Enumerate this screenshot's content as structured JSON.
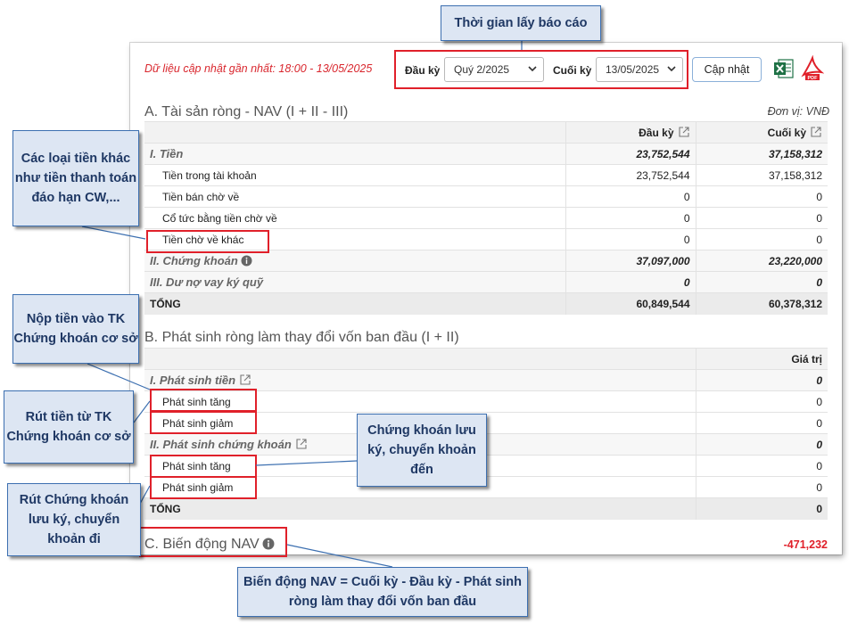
{
  "header": {
    "update_note": "Dữ liệu cập nhật gần nhất: 18:00 - 13/05/2025",
    "start_label": "Đầu kỳ",
    "start_value": "Quý 2/2025",
    "end_label": "Cuối kỳ",
    "end_value": "13/05/2025",
    "update_button": "Cập nhật"
  },
  "section_a": {
    "title": "A. Tài sản ròng - NAV (I + II - III)",
    "unit": "Đơn vị: VNĐ",
    "col_start": "Đầu kỳ",
    "col_end": "Cuối kỳ",
    "rows": [
      {
        "label": "I. Tiền",
        "start": "23,752,544",
        "end": "37,158,312"
      },
      {
        "label": "Tiền trong tài khoản",
        "start": "23,752,544",
        "end": "37,158,312"
      },
      {
        "label": "Tiền bán chờ về",
        "start": "0",
        "end": "0"
      },
      {
        "label": "Cổ tức bằng tiền chờ về",
        "start": "0",
        "end": "0"
      },
      {
        "label": "Tiền chờ về khác",
        "start": "0",
        "end": "0"
      },
      {
        "label": "II. Chứng khoán",
        "start": "37,097,000",
        "end": "23,220,000"
      },
      {
        "label": "III. Dư nợ vay ký quỹ",
        "start": "0",
        "end": "0"
      },
      {
        "label": "TỔNG",
        "start": "60,849,544",
        "end": "60,378,312"
      }
    ]
  },
  "section_b": {
    "title": "B. Phát sinh ròng làm thay đổi vốn ban đầu (I + II)",
    "col_value": "Giá trị",
    "rows": [
      {
        "label": "I. Phát sinh tiền",
        "value": "0"
      },
      {
        "label": "Phát sinh tăng",
        "value": "0"
      },
      {
        "label": "Phát sinh giảm",
        "value": "0"
      },
      {
        "label": "II. Phát sinh chứng khoán",
        "value": "0"
      },
      {
        "label": "Phát sinh tăng",
        "value": "0"
      },
      {
        "label": "Phát sinh giảm",
        "value": "0"
      },
      {
        "label": "TỔNG",
        "value": "0"
      }
    ]
  },
  "section_c": {
    "title": "C. Biến động NAV",
    "value": "-471,232"
  },
  "callouts": {
    "report_time": "Thời gian lấy báo cáo",
    "other_cash": "Các loại tiền khác như tiền thanh toán đáo hạn CW,...",
    "deposit": "Nộp tiền vào TK Chứng khoán cơ sở",
    "withdraw": "Rút tiền từ TK Chứng khoán cơ sở",
    "sec_in": "Chứng khoán lưu ký, chuyển khoản đến",
    "sec_out": "Rút Chứng khoán lưu ký, chuyển khoản đi",
    "nav_formula": "Biến động NAV = Cuối kỳ - Đầu kỳ - Phát sinh ròng làm thay đổi vốn ban đầu"
  },
  "colors": {
    "accent_red": "#e0202a",
    "callout_fill": "#dde6f3",
    "callout_border": "#3c6fb0",
    "callout_text": "#1f3864"
  },
  "icons": [
    "chevron-down-icon",
    "excel-icon",
    "pdf-icon",
    "external-link-icon",
    "info-icon"
  ]
}
